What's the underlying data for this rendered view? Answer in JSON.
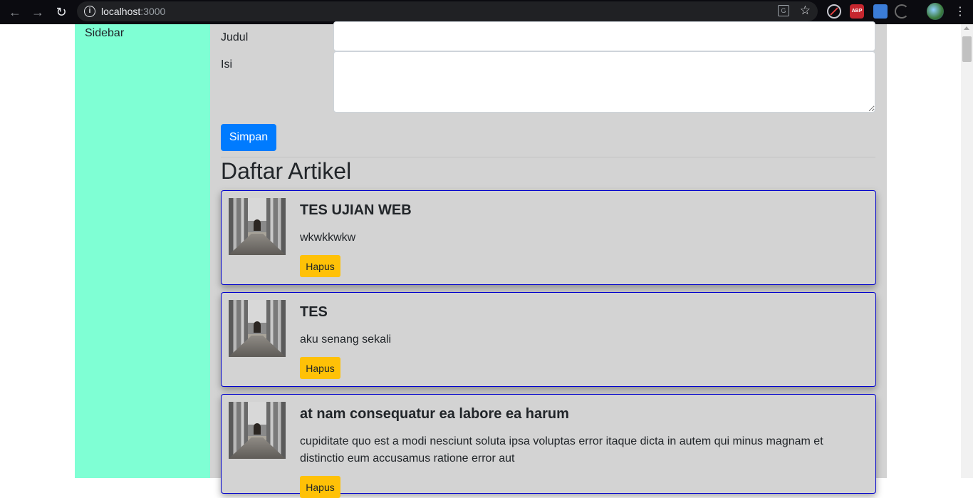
{
  "browser": {
    "url_host": "localhost",
    "url_port": ":3000",
    "back_icon": "arrow-left-icon",
    "forward_icon": "arrow-right-icon",
    "reload_icon": "reload-icon",
    "abp_label": "ABP"
  },
  "sidebar": {
    "label": "Sidebar"
  },
  "form": {
    "judul_label": "Judul",
    "isi_label": "Isi",
    "judul_value": "",
    "isi_value": "",
    "submit_label": "Simpan"
  },
  "list": {
    "title": "Daftar Artikel",
    "delete_label": "Hapus",
    "articles": [
      {
        "title": "TES UJIAN WEB",
        "body": "wkwkkwkw"
      },
      {
        "title": "TES",
        "body": "aku senang sekali"
      },
      {
        "title": "at nam consequatur ea labore ea harum",
        "body": "cupiditate quo est a modi nesciunt soluta ipsa voluptas error itaque dicta in autem qui minus magnam et distinctio eum accusamus ratione error aut"
      }
    ]
  },
  "colors": {
    "sidebar": "#7fffd4",
    "main": "#d3d3d3",
    "primary": "#007bff",
    "warning": "#ffc107",
    "card_border": "#0000cc"
  }
}
